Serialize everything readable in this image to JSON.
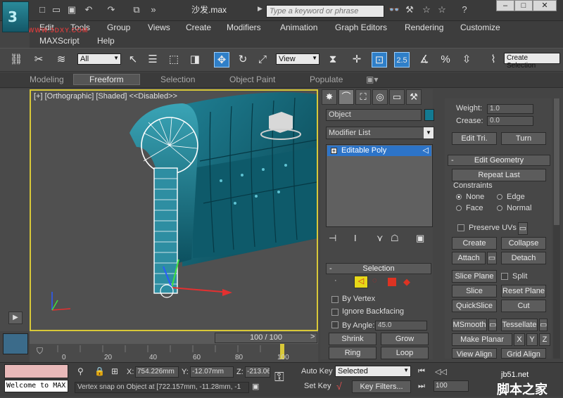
{
  "app": {
    "title": "沙发.max",
    "logo": "3ds-max-logo",
    "watermark": "WWW.3DXY.COM"
  },
  "search": {
    "placeholder": "Type a keyword or phrase"
  },
  "menus": [
    "Edit",
    "Tools",
    "Group",
    "Views",
    "Create",
    "Modifiers",
    "Animation",
    "Graph Editors",
    "Rendering",
    "Customize",
    "MAXScript",
    "Help"
  ],
  "toolbar": {
    "selection_filter": "All",
    "ref_coord": "View",
    "snap_value": "2.5",
    "named_set": "Create Selection"
  },
  "ribbon": {
    "tabs": [
      "Modeling",
      "Freeform",
      "Selection",
      "Object Paint",
      "Populate"
    ],
    "active": "Freeform"
  },
  "viewport": {
    "label": "[+] [Orthographic] [Shaded] <<Disabled>>",
    "nav_cube": "front"
  },
  "command_panel": {
    "object_name": "Object",
    "object_color": "#137a92",
    "modifier_list": "Modifier List",
    "stack_item": "Editable Poly",
    "selection_rollout": {
      "title": "Selection",
      "by_vertex": "By Vertex",
      "ignore_backfacing": "Ignore Backfacing",
      "by_angle": "By Angle:",
      "angle_value": "45.0",
      "shrink": "Shrink",
      "grow": "Grow",
      "ring": "Ring",
      "loop": "Loop"
    }
  },
  "edit_geometry": {
    "weight_label": "Weight:",
    "weight_value": "1.0",
    "crease_label": "Crease:",
    "crease_value": "0.0",
    "edit_tri": "Edit Tri.",
    "turn": "Turn",
    "title": "Edit Geometry",
    "repeat_last": "Repeat Last",
    "constraints": "Constraints",
    "none": "None",
    "edge": "Edge",
    "face": "Face",
    "normal": "Normal",
    "preserve_uvs": "Preserve UVs",
    "create": "Create",
    "collapse": "Collapse",
    "attach": "Attach",
    "detach": "Detach",
    "slice_plane": "Slice Plane",
    "split": "Split",
    "slice": "Slice",
    "reset_plane": "Reset Plane",
    "quickslice": "QuickSlice",
    "cut": "Cut",
    "msmooth": "MSmooth",
    "tessellate": "Tessellate",
    "make_planar": "Make Planar",
    "x": "X",
    "y": "Y",
    "z": "Z",
    "view_align": "View Align",
    "grid_align": "Grid Align"
  },
  "timeline": {
    "position": "100 / 100",
    "ticks": [
      "0",
      "20",
      "40",
      "60",
      "80",
      "100"
    ]
  },
  "status": {
    "maxscript_message": "Welcome to MAX",
    "x_label": "X:",
    "x": "754.226mm",
    "y_label": "Y:",
    "y": "-12.07mm",
    "z_label": "Z:",
    "z": "-213.06",
    "prompt": "Vertex snap on Object at [722.157mm, -11.28mm, -1",
    "auto_key": "Auto Key",
    "set_key": "Set Key",
    "key_mode": "Selected",
    "key_filters": "Key Filters...",
    "frame": "100"
  },
  "site_watermark": {
    "url": "jb51.net",
    "name": "脚本之家"
  }
}
